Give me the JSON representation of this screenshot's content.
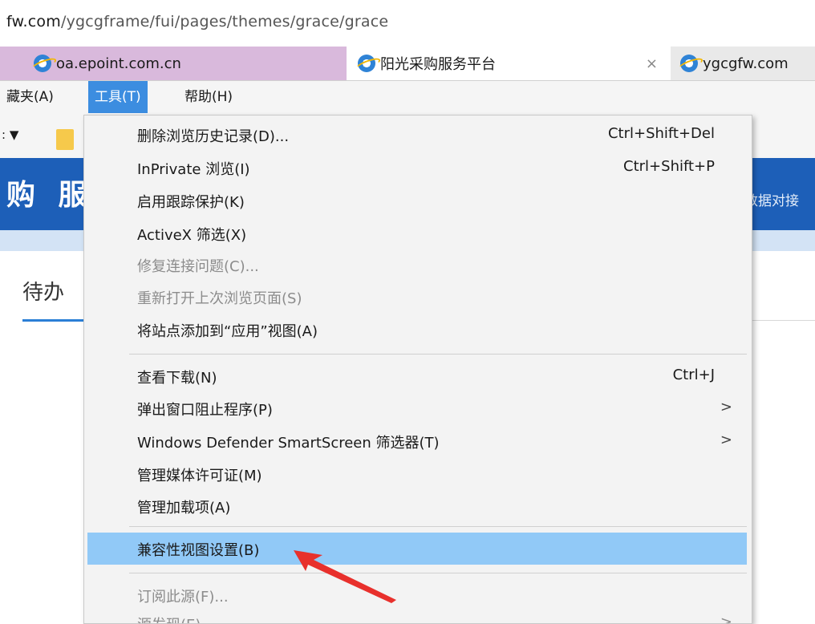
{
  "address_bar": {
    "host": "fw.com",
    "path": "/ygcgframe/fui/pages/themes/grace/grace"
  },
  "tabs": [
    {
      "label": "oa.epoint.com.cn"
    },
    {
      "label": "阳光采购服务平台",
      "close": "×"
    },
    {
      "label": "ygcgfw.com"
    }
  ],
  "menubar": {
    "favorites": "藏夹(A)",
    "tools": "工具(T)",
    "help": "帮助(H)"
  },
  "favrow": {
    "partial": ": ▼"
  },
  "page": {
    "banner_title": "购 服",
    "banner_link": "数据对接",
    "pending_tab": "待办"
  },
  "menu": {
    "items": [
      {
        "label": "删除浏览历史记录(D)...",
        "shortcut": "Ctrl+Shift+Del"
      },
      {
        "label": "InPrivate 浏览(I)",
        "shortcut": "Ctrl+Shift+P"
      },
      {
        "label": "启用跟踪保护(K)"
      },
      {
        "label": "ActiveX 筛选(X)"
      },
      {
        "label": "修复连接问题(C)...",
        "disabled": true
      },
      {
        "label": "重新打开上次浏览页面(S)",
        "disabled": true
      },
      {
        "label": "将站点添加到“应用”视图(A)"
      },
      {
        "label": "查看下载(N)",
        "shortcut": "Ctrl+J"
      },
      {
        "label": "弹出窗口阻止程序(P)",
        "arrow": ">"
      },
      {
        "label": "Windows Defender SmartScreen 筛选器(T)",
        "arrow": ">"
      },
      {
        "label": "管理媒体许可证(M)"
      },
      {
        "label": "管理加载项(A)"
      },
      {
        "label": "兼容性视图设置(B)",
        "highlighted": true
      },
      {
        "label": "订阅此源(F)...",
        "disabled": true
      },
      {
        "label": "源发现(E)",
        "disabled": true,
        "arrow": ">"
      }
    ]
  },
  "colors": {
    "menu_highlight": "#91c9f7",
    "active_menu": "#3c8de0",
    "banner": "#1d5fb8",
    "annotation_arrow": "#e8302c"
  }
}
